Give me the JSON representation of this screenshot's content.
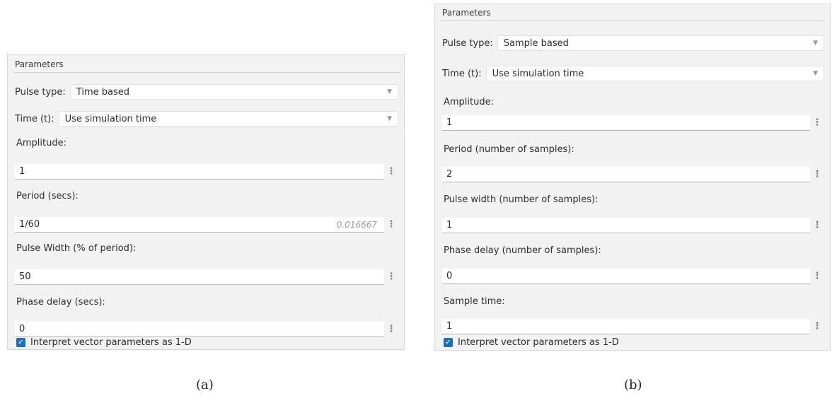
{
  "panel_a": {
    "group_title": "Parameters",
    "pulse_type": {
      "label": "Pulse type:",
      "value": "Time based"
    },
    "time": {
      "label": "Time (t):",
      "value": "Use simulation time"
    },
    "amplitude": {
      "label": "Amplitude:",
      "value": "1"
    },
    "period": {
      "label": "Period (secs):",
      "value": "1/60",
      "evaluated": "0.016667"
    },
    "pulse_width": {
      "label": "Pulse Width (% of period):",
      "value": "50"
    },
    "phase_delay": {
      "label": "Phase delay (secs):",
      "value": "0"
    },
    "interpret_1d": {
      "label": "Interpret vector parameters as 1-D",
      "checked": true
    },
    "caption": "(a)"
  },
  "panel_b": {
    "group_title": "Parameters",
    "pulse_type": {
      "label": "Pulse type:",
      "value": "Sample based"
    },
    "time": {
      "label": "Time (t):",
      "value": "Use simulation time"
    },
    "amplitude": {
      "label": "Amplitude:",
      "value": "1"
    },
    "period": {
      "label": "Period (number of samples):",
      "value": "2"
    },
    "pulse_width": {
      "label": "Pulse width (number of samples):",
      "value": "1"
    },
    "phase_delay": {
      "label": "Phase delay (number of samples):",
      "value": "0"
    },
    "sample_time": {
      "label": "Sample time:",
      "value": "1"
    },
    "interpret_1d": {
      "label": "Interpret vector parameters as 1-D",
      "checked": true
    },
    "caption": "(b)"
  },
  "icons": {
    "dropdown": "chevron-down-icon",
    "more": "vertical-ellipsis-icon",
    "check": "checkmark-icon"
  },
  "colors": {
    "panel_bg": "#f2f2f2",
    "checkbox": "#1f6fb5",
    "hint_text": "#9c9c9c"
  }
}
